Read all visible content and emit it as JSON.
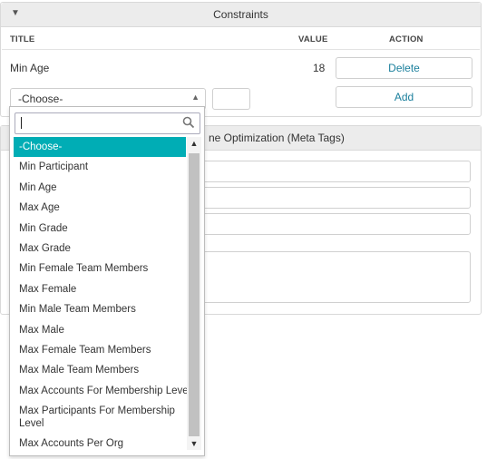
{
  "constraints": {
    "title": "Constraints",
    "columns": {
      "title": "TITLE",
      "value": "VALUE",
      "action": "ACTION"
    },
    "rows": [
      {
        "title": "Min Age",
        "value": "18",
        "action": "Delete"
      }
    ],
    "new_row": {
      "select_value": "-Choose-",
      "value": "",
      "add_label": "Add"
    }
  },
  "seo": {
    "title_fragment": "ne Optimization (Meta Tags)"
  },
  "dropdown": {
    "search_value": "",
    "options": [
      "-Choose-",
      "Min Participant",
      "Min Age",
      "Max Age",
      "Min Grade",
      "Max Grade",
      "Min Female Team Members",
      "Max Female",
      "Min Male Team Members",
      "Max Male",
      "Max Female Team Members",
      "Max Male Team Members",
      "Max Accounts For Membership Level",
      "Max Participants For Membership Level",
      "Max Accounts Per Org"
    ],
    "selected": "-Choose-"
  },
  "icons": {
    "collapse": "triangle-down-icon",
    "search": "search-icon",
    "select_arrow": "chevron-up-icon"
  },
  "colors": {
    "accent": "#00adb5",
    "link": "#1a7f9c"
  }
}
